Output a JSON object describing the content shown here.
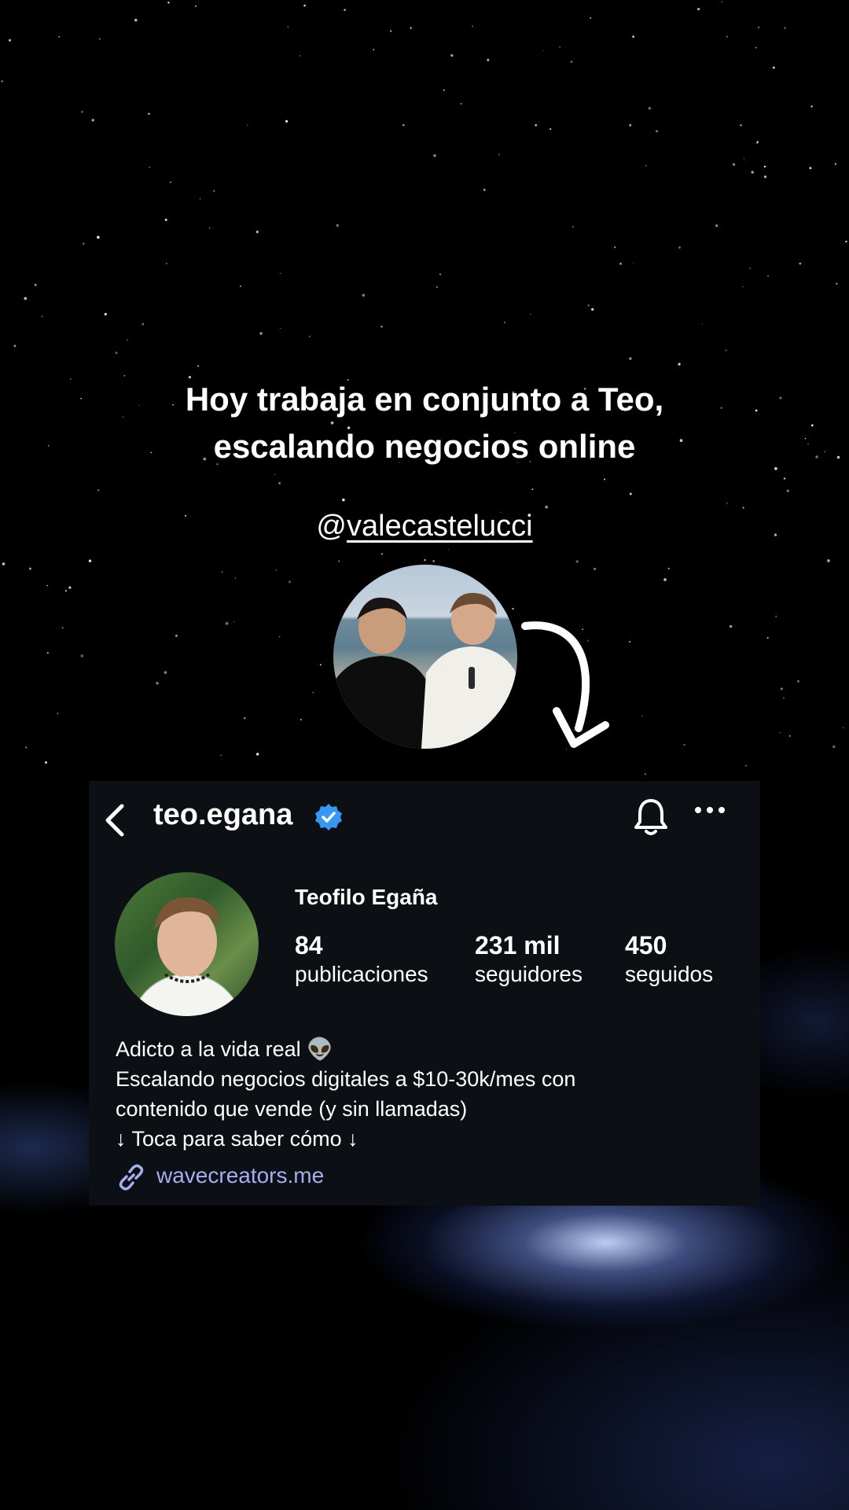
{
  "headline": {
    "line1": "Hoy trabaja en conjunto a Teo,",
    "line2": "escalando negocios online"
  },
  "handle": {
    "at": "@",
    "name": "valecastelucci"
  },
  "profile": {
    "username": "teo.egana",
    "display_name": "Teofilo Egaña",
    "stats": [
      {
        "value": "84",
        "label": "publicaciones"
      },
      {
        "value": "231 mil",
        "label": "seguidores"
      },
      {
        "value": "450",
        "label": "seguidos"
      }
    ],
    "bio": [
      "Adicto a la vida real 👽",
      "Escalando negocios digitales a $10-30k/mes con",
      "contenido que vende (y sin llamadas)",
      "↓ Toca para saber cómo ↓"
    ],
    "link": "wavecreators.me"
  },
  "icons": {
    "back": "back-arrow-icon",
    "verified": "verified-badge-icon",
    "bell": "bell-icon",
    "more": "more-options-icon",
    "link": "link-icon",
    "arrow": "curved-arrow-icon"
  },
  "colors": {
    "panel_bg": "#0c0f14",
    "verified": "#3897f0",
    "link": "#a4aef0"
  }
}
